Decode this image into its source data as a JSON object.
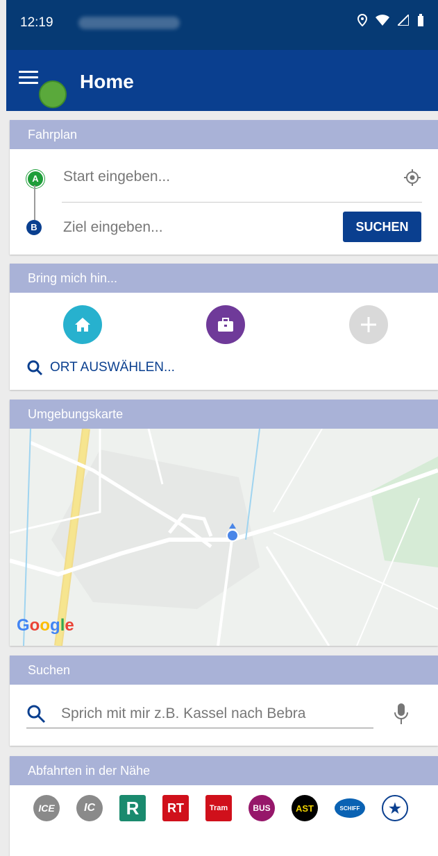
{
  "status_bar": {
    "time": "12:19"
  },
  "app_bar": {
    "title": "Home"
  },
  "fahrplan": {
    "header": "Fahrplan",
    "pin_a": "A",
    "pin_b": "B",
    "start_placeholder": "Start eingeben...",
    "ziel_placeholder": "Ziel eingeben...",
    "search_button": "SUCHEN"
  },
  "bring": {
    "header": "Bring mich hin...",
    "select_place": "ORT AUSWÄHLEN..."
  },
  "map": {
    "header": "Umgebungskarte",
    "logo": "Google"
  },
  "suchen": {
    "header": "Suchen",
    "placeholder": "Sprich mit mir z.B. Kassel nach Bebra"
  },
  "abfahrten": {
    "header": "Abfahrten in der Nähe",
    "modes": [
      {
        "label": "ICE"
      },
      {
        "label": "IC"
      },
      {
        "label": "R"
      },
      {
        "label": "RT"
      },
      {
        "label": "Tram"
      },
      {
        "label": "BUS"
      },
      {
        "label": "AST"
      },
      {
        "label": "SCHIFF"
      },
      {
        "label": "★"
      }
    ]
  },
  "colors": {
    "primary": "#0a3f8f",
    "section_header": "#a9b2d7",
    "home": "#27b1ce",
    "work": "#6f3a99"
  }
}
